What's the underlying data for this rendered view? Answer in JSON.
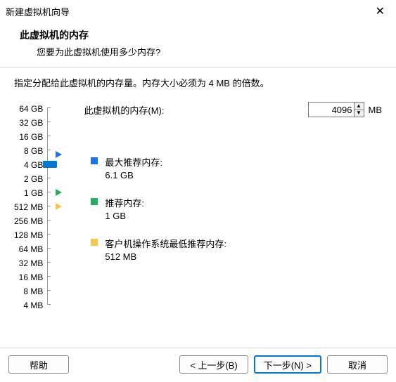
{
  "window": {
    "title": "新建虚拟机向导"
  },
  "header": {
    "title": "此虚拟机的内存",
    "subtitle": "您要为此虚拟机使用多少内存?"
  },
  "instruction": "指定分配给此虚拟机的内存量。内存大小必须为 4 MB 的倍数。",
  "memory": {
    "label": "此虚拟机的内存(M):",
    "value": "4096",
    "unit": "MB"
  },
  "ruler": {
    "labels": [
      "64 GB",
      "32 GB",
      "16 GB",
      "8 GB",
      "4 GB",
      "2 GB",
      "1 GB",
      "512 MB",
      "256 MB",
      "128 MB",
      "64 MB",
      "32 MB",
      "16 MB",
      "8 MB",
      "4 MB"
    ]
  },
  "markers": {
    "max": {
      "title": "最大推荐内存:",
      "value": "6.1 GB"
    },
    "rec": {
      "title": "推荐内存:",
      "value": "1 GB"
    },
    "min": {
      "title": "客户机操作系统最低推荐内存:",
      "value": "512 MB"
    }
  },
  "buttons": {
    "help": "帮助",
    "back": "< 上一步(B)",
    "next": "下一步(N) >",
    "cancel": "取消"
  }
}
